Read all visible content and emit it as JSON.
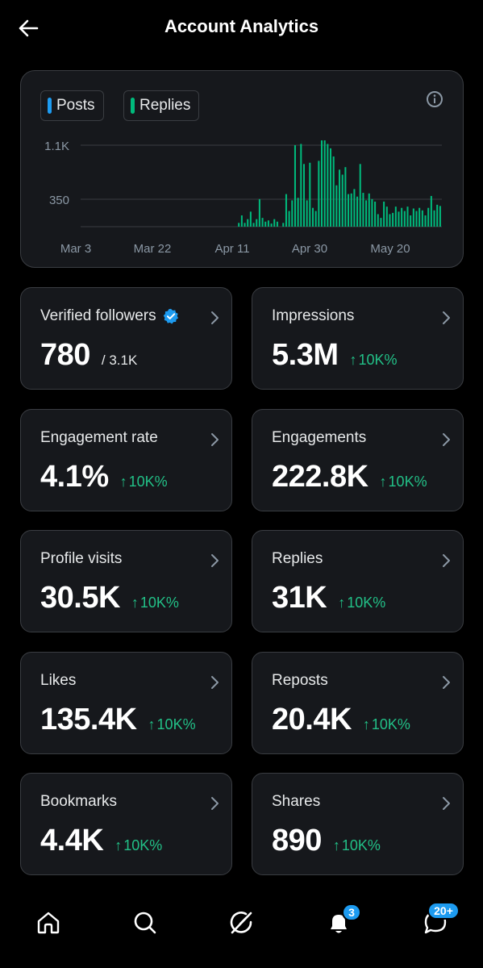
{
  "header": {
    "title": "Account Analytics",
    "back_icon": "arrow-left-icon"
  },
  "chart": {
    "legend": {
      "posts_label": "Posts",
      "replies_label": "Replies"
    },
    "colors": {
      "posts": "#1d9bf0",
      "replies": "#00ba7c"
    },
    "info_icon": "info-icon"
  },
  "chart_data": {
    "type": "bar",
    "y_ticks": [
      "1.1K",
      "350"
    ],
    "x_ticks": [
      "Mar 3",
      "Mar 22",
      "Apr 11",
      "Apr 30",
      "May 20"
    ],
    "ylim": [
      0,
      1300
    ],
    "grid": true,
    "series": [
      {
        "name": "Replies",
        "values": [
          0,
          0,
          0,
          0,
          0,
          0,
          0,
          0,
          0,
          0,
          0,
          0,
          0,
          0,
          0,
          0,
          0,
          0,
          0,
          0,
          0,
          0,
          0,
          0,
          0,
          0,
          0,
          0,
          0,
          0,
          0,
          0,
          0,
          0,
          0,
          0,
          0,
          0,
          0,
          0,
          0,
          0,
          0,
          0,
          0,
          0,
          0,
          0,
          0,
          0,
          0,
          0,
          0,
          60,
          180,
          60,
          120,
          240,
          60,
          120,
          440,
          140,
          80,
          100,
          50,
          120,
          80,
          0,
          60,
          520,
          250,
          420,
          1300,
          460,
          1320,
          1000,
          420,
          1020,
          300,
          250,
          1050,
          1400,
          1450,
          1320,
          1250,
          1120,
          660,
          910,
          830,
          950,
          520,
          530,
          600,
          480,
          1000,
          540,
          420,
          530,
          440,
          400,
          200,
          140,
          400,
          320,
          200,
          220,
          320,
          240,
          300,
          250,
          320,
          180,
          290,
          250,
          300,
          260,
          180,
          300,
          490,
          260,
          350,
          330
        ]
      }
    ]
  },
  "metrics": [
    {
      "label": "Verified followers",
      "value": "780",
      "sub": "/ 3.1K",
      "verified": true
    },
    {
      "label": "Impressions",
      "value": "5.3M",
      "change": "10K%"
    },
    {
      "label": "Engagement rate",
      "value": "4.1%",
      "change": "10K%"
    },
    {
      "label": "Engagements",
      "value": "222.8K",
      "change": "10K%"
    },
    {
      "label": "Profile visits",
      "value": "30.5K",
      "change": "10K%"
    },
    {
      "label": "Replies",
      "value": "31K",
      "change": "10K%"
    },
    {
      "label": "Likes",
      "value": "135.4K",
      "change": "10K%"
    },
    {
      "label": "Reposts",
      "value": "20.4K",
      "change": "10K%"
    },
    {
      "label": "Bookmarks",
      "value": "4.4K",
      "change": "10K%"
    },
    {
      "label": "Shares",
      "value": "890",
      "change": "10K%"
    }
  ],
  "change_arrow": "↑",
  "nav": {
    "items": [
      "home-icon",
      "search-icon",
      "grok-icon",
      "notifications-icon",
      "messages-icon"
    ],
    "notifications_badge": "3",
    "messages_badge": "20+"
  }
}
